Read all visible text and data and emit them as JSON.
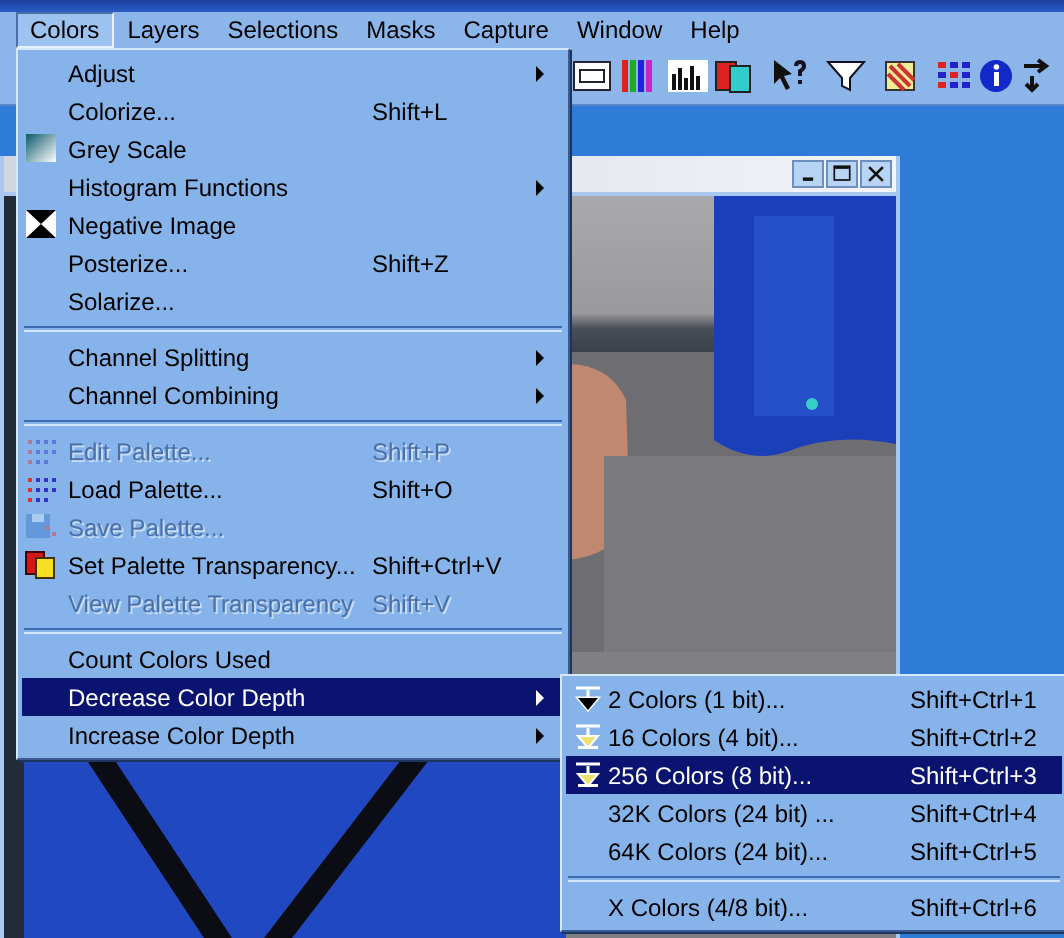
{
  "menubar": [
    {
      "label": "Colors",
      "selected": true
    },
    {
      "label": "Layers",
      "selected": false
    },
    {
      "label": "Selections",
      "selected": false
    },
    {
      "label": "Masks",
      "selected": false
    },
    {
      "label": "Capture",
      "selected": false
    },
    {
      "label": "Window",
      "selected": false
    },
    {
      "label": "Help",
      "selected": false
    }
  ],
  "colors_menu": [
    {
      "kind": "item",
      "label": "Adjust",
      "submenu": true,
      "disabled": false,
      "selected": false
    },
    {
      "kind": "item",
      "label": "Colorize...",
      "shortcut": "Shift+L",
      "submenu": false,
      "disabled": false,
      "selected": false
    },
    {
      "kind": "item",
      "label": "Grey Scale",
      "submenu": false,
      "disabled": false,
      "selected": false
    },
    {
      "kind": "item",
      "label": "Histogram Functions",
      "submenu": true,
      "disabled": false,
      "selected": false
    },
    {
      "kind": "item",
      "label": "Negative Image",
      "submenu": false,
      "disabled": false,
      "selected": false
    },
    {
      "kind": "item",
      "label": "Posterize...",
      "shortcut": "Shift+Z",
      "submenu": false,
      "disabled": false,
      "selected": false
    },
    {
      "kind": "item",
      "label": "Solarize...",
      "submenu": false,
      "disabled": false,
      "selected": false
    },
    {
      "kind": "separator"
    },
    {
      "kind": "item",
      "label": "Channel Splitting",
      "submenu": true,
      "disabled": false,
      "selected": false
    },
    {
      "kind": "item",
      "label": "Channel Combining",
      "submenu": true,
      "disabled": false,
      "selected": false
    },
    {
      "kind": "separator"
    },
    {
      "kind": "item",
      "label": "Edit Palette...",
      "shortcut": "Shift+P",
      "submenu": false,
      "disabled": true,
      "selected": false
    },
    {
      "kind": "item",
      "label": "Load Palette...",
      "shortcut": "Shift+O",
      "submenu": false,
      "disabled": false,
      "selected": false
    },
    {
      "kind": "item",
      "label": "Save Palette...",
      "submenu": false,
      "disabled": true,
      "selected": false
    },
    {
      "kind": "item",
      "label": "Set Palette Transparency...",
      "shortcut": "Shift+Ctrl+V",
      "submenu": false,
      "disabled": false,
      "selected": false
    },
    {
      "kind": "item",
      "label": "View Palette Transparency",
      "shortcut": "Shift+V",
      "submenu": false,
      "disabled": true,
      "selected": false
    },
    {
      "kind": "separator"
    },
    {
      "kind": "item",
      "label": "Count Colors Used",
      "submenu": false,
      "disabled": false,
      "selected": false
    },
    {
      "kind": "item",
      "label": "Decrease Color Depth",
      "submenu": true,
      "disabled": false,
      "selected": true
    },
    {
      "kind": "item",
      "label": "Increase Color Depth",
      "submenu": true,
      "disabled": false,
      "selected": false
    }
  ],
  "decrease_submenu": [
    {
      "kind": "item",
      "label": "2 Colors (1 bit)...",
      "shortcut": "Shift+Ctrl+1",
      "submenu": false,
      "disabled": false,
      "selected": false
    },
    {
      "kind": "item",
      "label": "16 Colors (4 bit)...",
      "shortcut": "Shift+Ctrl+2",
      "submenu": false,
      "disabled": false,
      "selected": false
    },
    {
      "kind": "item",
      "label": "256 Colors (8 bit)...",
      "shortcut": "Shift+Ctrl+3",
      "submenu": false,
      "disabled": false,
      "selected": true
    },
    {
      "kind": "item",
      "label": "32K Colors (24 bit) ...",
      "shortcut": "Shift+Ctrl+4",
      "submenu": false,
      "disabled": false,
      "selected": false
    },
    {
      "kind": "item",
      "label": "64K Colors (24 bit)...",
      "shortcut": "Shift+Ctrl+5",
      "submenu": false,
      "disabled": false,
      "selected": false
    },
    {
      "kind": "separator"
    },
    {
      "kind": "item",
      "label": "X Colors (4/8 bit)...",
      "shortcut": "Shift+Ctrl+6",
      "submenu": false,
      "disabled": false,
      "selected": false
    }
  ]
}
